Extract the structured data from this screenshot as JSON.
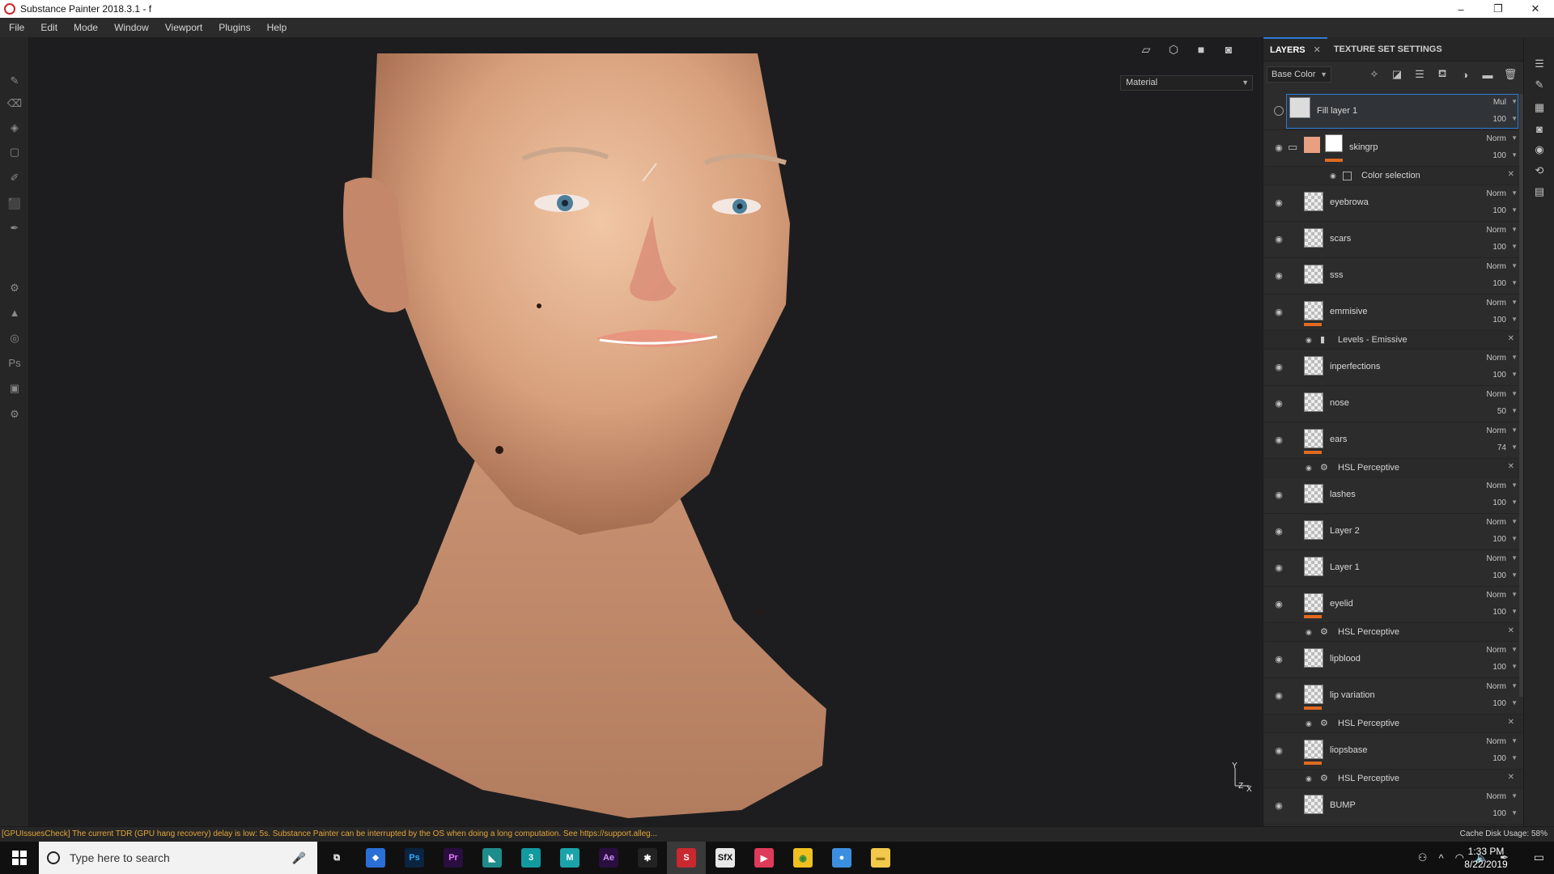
{
  "window": {
    "title": "Substance Painter 2018.3.1 - f",
    "controls": [
      "–",
      "❐",
      "✕"
    ]
  },
  "menu": [
    "File",
    "Edit",
    "Mode",
    "Window",
    "Viewport",
    "Plugins",
    "Help"
  ],
  "viewport": {
    "channel_select": "Material",
    "axis": {
      "y": "Y",
      "z": "Z",
      "x": "X"
    }
  },
  "panel": {
    "tabs": {
      "layers": "LAYERS",
      "close": "✕",
      "texture_set": "TEXTURE SET SETTINGS"
    },
    "channel": "Base Color",
    "layers": [
      {
        "name": "Fill layer 1",
        "blend": "Mul",
        "opacity": "100",
        "selected": true
      },
      {
        "name": "skingrp",
        "blend": "Norm",
        "opacity": "100",
        "group": true
      },
      {
        "effect": "Color selection",
        "indent": 2
      },
      {
        "name": "eyebrowa",
        "blend": "Norm",
        "opacity": "100"
      },
      {
        "name": "scars",
        "blend": "Norm",
        "opacity": "100"
      },
      {
        "name": "sss",
        "blend": "Norm",
        "opacity": "100"
      },
      {
        "name": "emmisive",
        "blend": "Norm",
        "opacity": "100"
      },
      {
        "effect": "Levels - Emissive",
        "indent": 1
      },
      {
        "name": "inperfections",
        "blend": "Norm",
        "opacity": "100"
      },
      {
        "name": "nose",
        "blend": "Norm",
        "opacity": "50"
      },
      {
        "name": "ears",
        "blend": "Norm",
        "opacity": "74"
      },
      {
        "effect": "HSL Perceptive",
        "indent": 1
      },
      {
        "name": "lashes",
        "blend": "Norm",
        "opacity": "100"
      },
      {
        "name": "Layer 2",
        "blend": "Norm",
        "opacity": "100"
      },
      {
        "name": "Layer 1",
        "blend": "Norm",
        "opacity": "100"
      },
      {
        "name": "eyelid",
        "blend": "Norm",
        "opacity": "100"
      },
      {
        "effect": "HSL Perceptive",
        "indent": 1
      },
      {
        "name": "lipblood",
        "blend": "Norm",
        "opacity": "100"
      },
      {
        "name": "lip variation",
        "blend": "Norm",
        "opacity": "100"
      },
      {
        "effect": "HSL Perceptive",
        "indent": 1
      },
      {
        "name": "liopsbase",
        "blend": "Norm",
        "opacity": "100"
      },
      {
        "effect": "HSL Perceptive",
        "indent": 1
      },
      {
        "name": "BUMP",
        "blend": "Norm",
        "opacity": "100"
      }
    ]
  },
  "status": {
    "message": "[GPUIssuesCheck] The current TDR (GPU hang recovery) delay is low: 5s. Substance Painter can be interrupted by the OS when doing a long computation. See https://support.alleg...",
    "cache": "Cache Disk Usage:   58%"
  },
  "taskbar": {
    "search_placeholder": "Type here to search",
    "apps": [
      {
        "name": "task-view",
        "label": "⧉",
        "bg": "#101010",
        "fg": "#ffffff"
      },
      {
        "name": "app-blue",
        "label": "⬥",
        "bg": "#2a6fd6",
        "fg": "#ffffff"
      },
      {
        "name": "photoshop",
        "label": "Ps",
        "bg": "#0b2440",
        "fg": "#31a8ff"
      },
      {
        "name": "premiere",
        "label": "Pr",
        "bg": "#2a0e3f",
        "fg": "#ea77ff"
      },
      {
        "name": "designer",
        "label": "◣",
        "bg": "#1e8c8a",
        "fg": "#ffffff"
      },
      {
        "name": "3dsmax",
        "label": "3",
        "bg": "#129a9f",
        "fg": "#ffffff"
      },
      {
        "name": "maya",
        "label": "M",
        "bg": "#1aa3a8",
        "fg": "#ffffff"
      },
      {
        "name": "aftereffects",
        "label": "Ae",
        "bg": "#2a0e3f",
        "fg": "#cf96fd"
      },
      {
        "name": "zbrush",
        "label": "✱",
        "bg": "#222222",
        "fg": "#ffffff"
      },
      {
        "name": "substance-painter",
        "label": "S",
        "bg": "#c8282e",
        "fg": "#ffffff"
      },
      {
        "name": "sfx",
        "label": "SfX",
        "bg": "#e8e8e8",
        "fg": "#111111"
      },
      {
        "name": "media",
        "label": "▶",
        "bg": "#e03a5a",
        "fg": "#ffffff"
      },
      {
        "name": "chrome",
        "label": "◉",
        "bg": "#f0c020",
        "fg": "#2a8a3a"
      },
      {
        "name": "app-orb",
        "label": "●",
        "bg": "#3b8fe0",
        "fg": "#ffffff"
      },
      {
        "name": "file-explorer",
        "label": "▬",
        "bg": "#f2c94c",
        "fg": "#a07810"
      }
    ],
    "time": "1:33 PM",
    "date": "8/22/2019"
  }
}
